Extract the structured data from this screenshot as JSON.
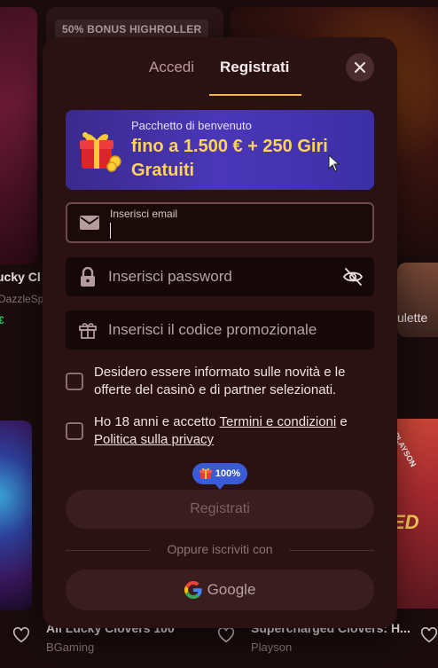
{
  "background": {
    "promo_badge": "50% BONUS HIGHROLLER",
    "left_game_title_fragment": "ucky Cl",
    "left_game_provider_fragment": "DazzleSpi",
    "left_game_green_fragment": "€",
    "right_game_title_fragment": "ulette",
    "right_provider_badge": "PLAYSON",
    "right_game_logo_fragment": "ED",
    "bottom_left_game_title": "All Lucky Clovers 100",
    "bottom_left_game_provider": "BGaming",
    "bottom_right_game_title": "Supercharged Clovers: H...",
    "bottom_right_game_provider": "Playson"
  },
  "modal": {
    "tabs": [
      {
        "label": "Accedi",
        "active": false
      },
      {
        "label": "Registrati",
        "active": true
      }
    ],
    "close_icon": "close-icon",
    "bonus": {
      "title": "Pacchetto di benvenuto",
      "offer": "fino a 1.500 € + 250 Giri Gratuiti",
      "icon": "gift-icon"
    },
    "email": {
      "label": "Inserisci email",
      "value": "",
      "icon": "envelope-icon"
    },
    "password": {
      "placeholder": "Inserisci password",
      "value": "",
      "icon": "lock-icon",
      "toggle_icon": "eye-off-icon"
    },
    "promo": {
      "placeholder": "Inserisci il codice promozionale",
      "value": "",
      "icon": "gift-icon"
    },
    "consent_marketing": {
      "text": "Desidero essere informato sulle novità e le offerte del casinò e di partner selezionati.",
      "checked": false
    },
    "consent_terms": {
      "prefix": "Ho 18 anni e accetto ",
      "terms_link": "Termini e condizioni",
      "middle": " e ",
      "privacy_link": "Politica sulla privacy",
      "checked": false
    },
    "progress_badge": "100%",
    "submit_label": "Registrati",
    "divider_text": "Oppure iscriviti con",
    "google_label": "Google"
  },
  "colors": {
    "modal_bg": "#2a1213",
    "accent_underline": "#f2b54b",
    "bonus_gradient_start": "#3a2a8c",
    "bonus_text": "#ffd35a",
    "badge_blue": "#3b5bd6"
  }
}
